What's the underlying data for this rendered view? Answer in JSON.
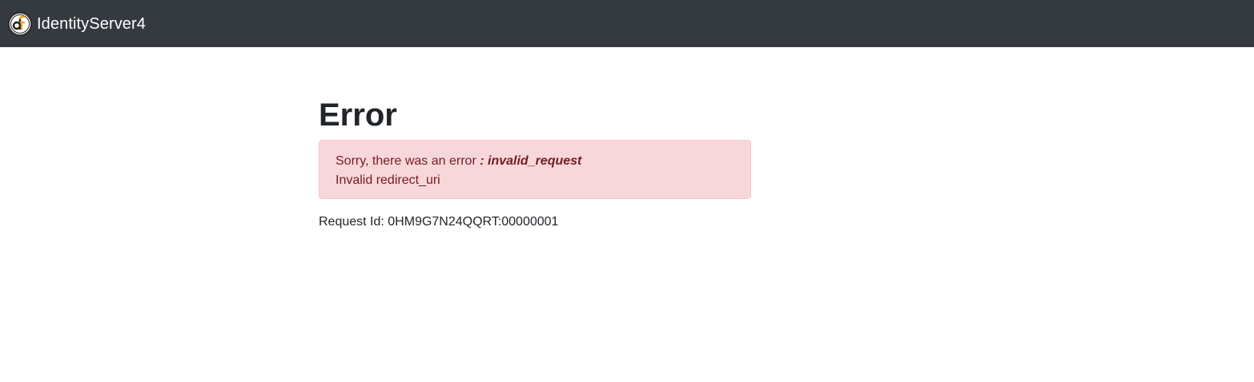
{
  "navbar": {
    "brand_name": "IdentityServer4",
    "logo_icon": "identityserver-logo-icon",
    "background_color": "#343a40"
  },
  "main": {
    "title": "Error",
    "alert": {
      "message_prefix": "Sorry, there was an error",
      "error_code": ": invalid_request",
      "error_description": "Invalid redirect_uri",
      "background_color": "#f8d7da",
      "text_color": "#721c24"
    },
    "request_id_label": "Request Id:",
    "request_id_value": "0HM9G7N24QQRT:00000001"
  }
}
